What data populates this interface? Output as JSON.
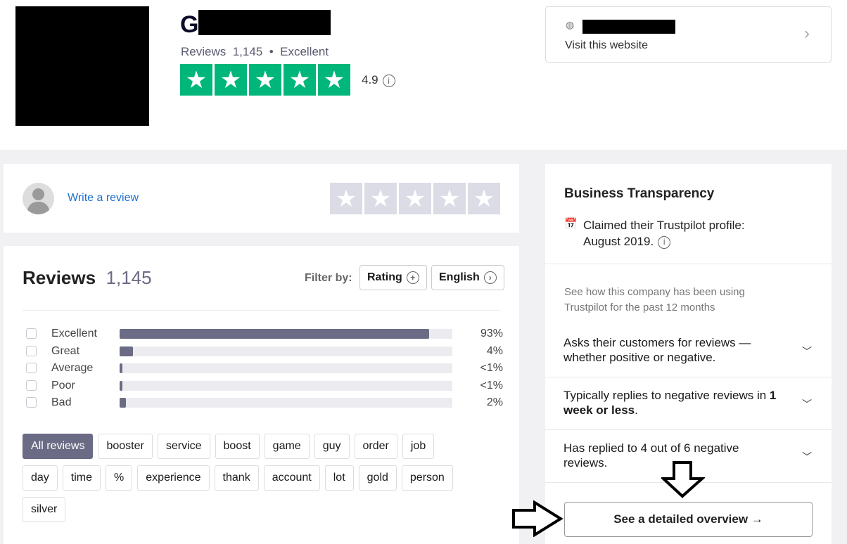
{
  "header": {
    "company_initial": "G",
    "reviews_label": "Reviews",
    "reviews_count": "1,145",
    "rating_label": "Excellent",
    "score": "4.9",
    "stars_filled": 5,
    "star_color": "#00b67a"
  },
  "website": {
    "visit_label": "Visit this website"
  },
  "write_review": {
    "label": "Write a review"
  },
  "reviews": {
    "title": "Reviews",
    "count": "1,145",
    "filter_label": "Filter by:",
    "filters": [
      "Rating",
      "English"
    ],
    "distribution": [
      {
        "label": "Excellent",
        "pct": "93%",
        "value": 93
      },
      {
        "label": "Great",
        "pct": "4%",
        "value": 4
      },
      {
        "label": "Average",
        "pct": "<1%",
        "value": 0.8
      },
      {
        "label": "Poor",
        "pct": "<1%",
        "value": 0.8
      },
      {
        "label": "Bad",
        "pct": "2%",
        "value": 2
      }
    ],
    "tags": [
      "All reviews",
      "booster",
      "service",
      "boost",
      "game",
      "guy",
      "order",
      "job",
      "day",
      "time",
      "%",
      "experience",
      "thank",
      "account",
      "lot",
      "gold",
      "person",
      "silver"
    ]
  },
  "transparency": {
    "title": "Business Transparency",
    "claimed_line1": "Claimed their Trustpilot profile:",
    "claimed_line2": "August 2019.",
    "intro": "See how this company has been using Trustpilot for the past 12 months",
    "items": [
      {
        "pre": "Asks their customers for reviews — whether positive or negative.",
        "bold": "",
        "post": ""
      },
      {
        "pre": "Typically replies to negative reviews in ",
        "bold": "1 week or less",
        "post": "."
      },
      {
        "pre": "Has replied to 4 out of 6 negative reviews.",
        "bold": "",
        "post": ""
      }
    ],
    "button": "See a detailed overview →"
  }
}
